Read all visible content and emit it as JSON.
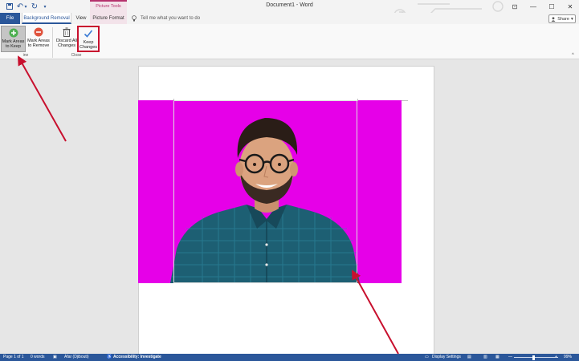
{
  "window": {
    "title": "Document1  -  Word",
    "context_group": "Picture Tools",
    "controls": {
      "minimize": "—",
      "maximize": "☐",
      "close": "✕",
      "ribbon_options": "⊡"
    }
  },
  "quick_access": {
    "save_icon": "save-icon",
    "undo_glyph": "↶",
    "undo_dropdown": "▾",
    "redo_glyph": "↻",
    "customize_glyph": "▾"
  },
  "tabs": {
    "file": "File",
    "background_removal": "Background Removal",
    "view": "View",
    "picture_format": "Picture Format"
  },
  "tell_me": {
    "icon": "lightbulb-icon",
    "placeholder": "Tell me what you want to do"
  },
  "share": {
    "label": "Share",
    "glyph": "▾"
  },
  "ribbon": {
    "groups": {
      "refine": "ine",
      "close": "Close"
    },
    "buttons": {
      "mark_keep": {
        "line1": "Mark Areas",
        "line2": "to Keep"
      },
      "mark_remove": {
        "line1": "Mark Areas",
        "line2": "to Remove"
      },
      "discard": {
        "line1": "Discard All",
        "line2": "Changes"
      },
      "keep_changes": {
        "line1": "Keep",
        "line2": "Changes"
      }
    },
    "collapse_glyph": "^"
  },
  "status_bar": {
    "page": "Page 1 of 1",
    "words": "0 words",
    "language": "Afar (Djibouti)",
    "accessibility": "Accessibility: Investigate",
    "display_settings": "Display Settings",
    "zoom": "99%",
    "zoom_minus": "—",
    "zoom_plus": "+"
  },
  "colors": {
    "accent": "#2b579a",
    "context_tab": "#b5316d",
    "removal_overlay": "#e600e8",
    "highlight_box": "#c8102e"
  }
}
